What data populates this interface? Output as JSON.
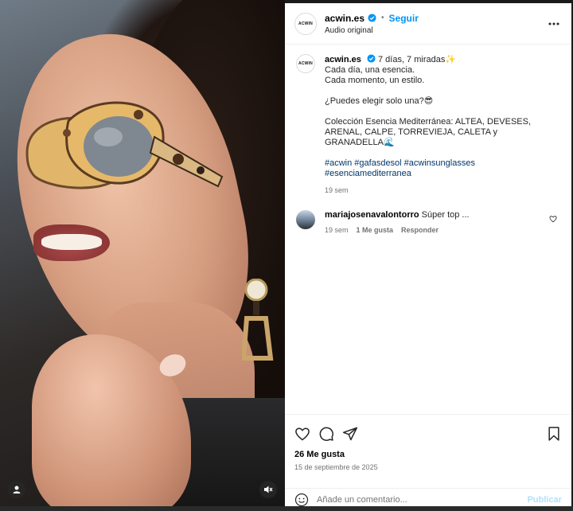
{
  "post": {
    "username": "acwin.es",
    "avatar_text": "ACWIN",
    "follow_label": "Seguir",
    "dot": "•",
    "audio": "Audio original"
  },
  "caption": {
    "username": "acwin.es",
    "headline": "7 días, 7 miradas✨",
    "lines": [
      "Cada día, una esencia.",
      "Cada momento, un estilo.",
      "¿Puedes elegir solo una?😎",
      "Colección Esencia Mediterránea: ALTEA, DEVESES, ARENAL, CALPE, TORREVIEJA, CALETA y GRANADELLA🌊"
    ],
    "hashtags": "#acwin #gafasdesol #acwinsunglasses #esenciamediterranea",
    "time": "19 sem"
  },
  "comments": [
    {
      "username": "mariajosenavalontorro",
      "text": "Súper top ...",
      "time": "19 sem",
      "likes": "1 Me gusta",
      "reply": "Responder"
    }
  ],
  "footer": {
    "likes": "26 Me gusta",
    "date": "15 de septiembre de 2025",
    "comment_placeholder": "Añade un comentario...",
    "publish_label": "Publicar"
  },
  "colors": {
    "accent": "#0095f6",
    "hashtag": "#00376b",
    "publish_disabled": "#b2dffc",
    "muted": "#737373"
  },
  "icons": [
    "verified-badge-icon",
    "more-icon",
    "heart-icon",
    "comment-icon",
    "share-icon",
    "save-icon",
    "emoji-icon",
    "user-tag-icon",
    "mute-icon"
  ]
}
